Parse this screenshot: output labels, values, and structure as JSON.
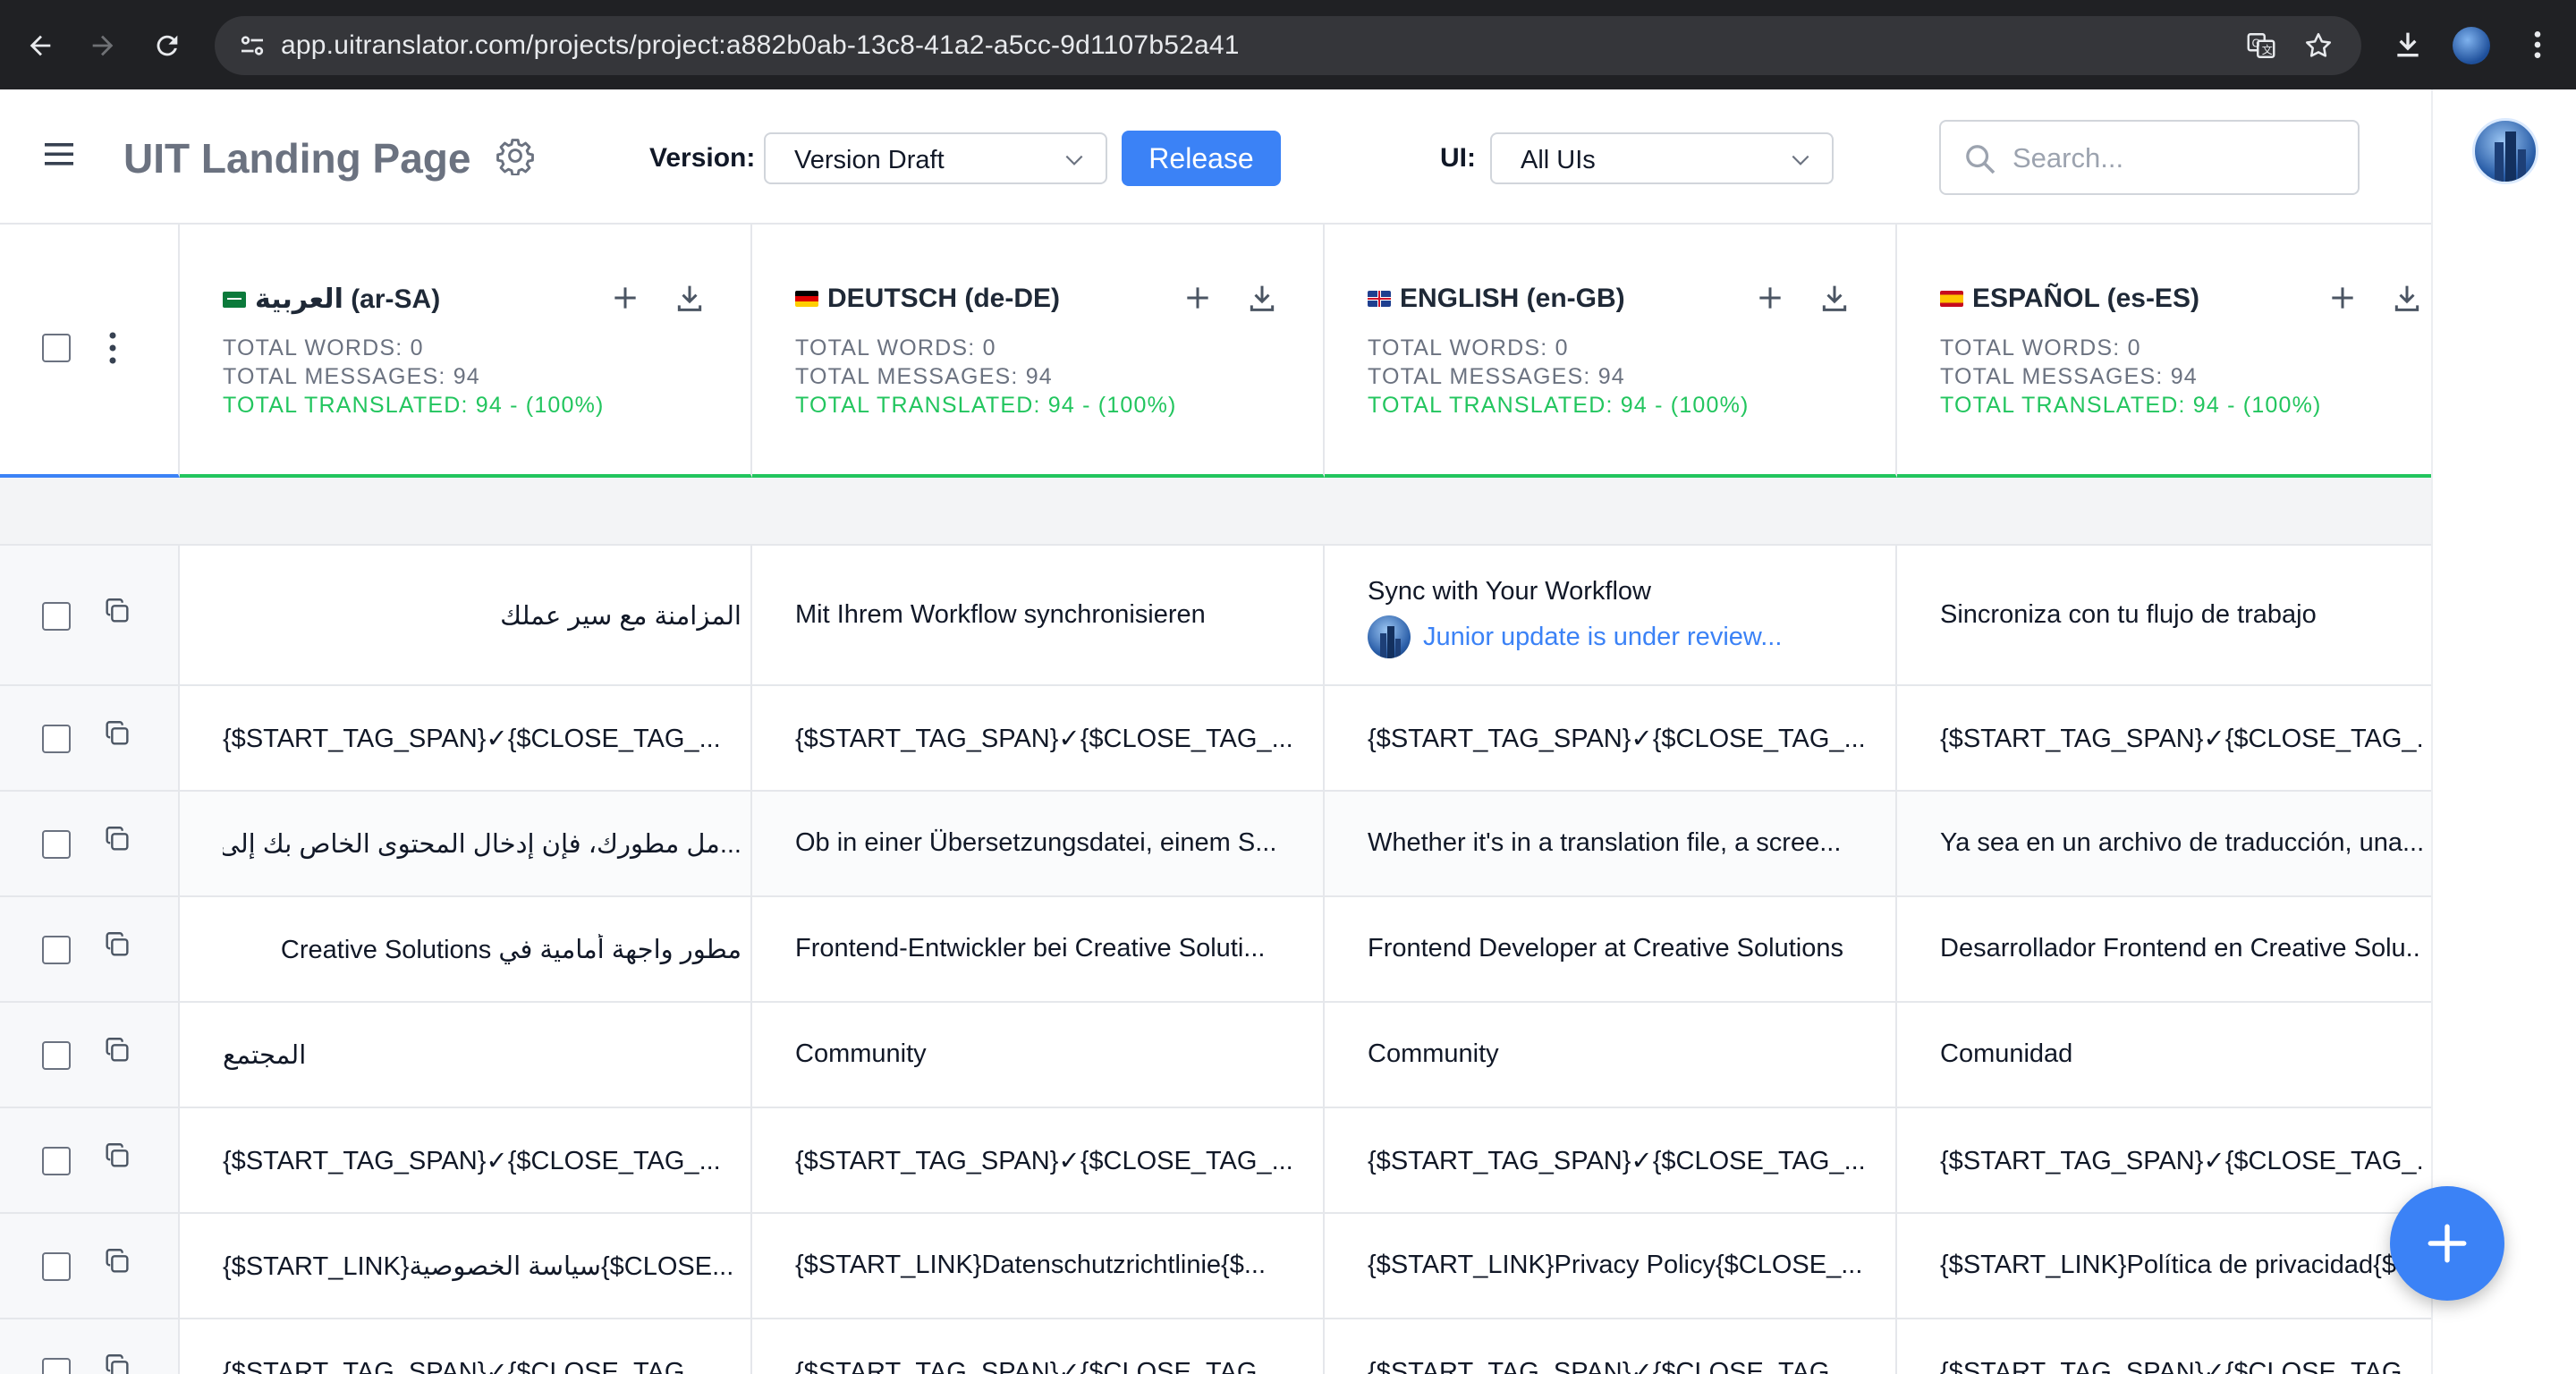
{
  "browser": {
    "url": "app.uitranslator.com/projects/project:a882b0ab-13c8-41a2-a5cc-9d1107b52a41"
  },
  "header": {
    "project_title": "UIT Landing Page",
    "version_label": "Version:",
    "version_value": "Version Draft",
    "release_label": "Release",
    "ui_label": "UI:",
    "ui_value": "All UIs",
    "search_placeholder": "Search..."
  },
  "languages": [
    {
      "name": "العربية (ar-SA)",
      "words": "TOTAL WORDS: 0",
      "messages": "TOTAL MESSAGES: 94",
      "translated": "TOTAL TRANSLATED: 94 - (100%)"
    },
    {
      "name": "DEUTSCH (de-DE)",
      "words": "TOTAL WORDS: 0",
      "messages": "TOTAL MESSAGES: 94",
      "translated": "TOTAL TRANSLATED: 94 - (100%)"
    },
    {
      "name": "ENGLISH (en-GB)",
      "words": "TOTAL WORDS: 0",
      "messages": "TOTAL MESSAGES: 94",
      "translated": "TOTAL TRANSLATED: 94 - (100%)"
    },
    {
      "name": "ESPAÑOL (es-ES)",
      "words": "TOTAL WORDS: 0",
      "messages": "TOTAL MESSAGES: 94",
      "translated": "TOTAL TRANSLATED: 94 - (100%)"
    }
  ],
  "rows": [
    [
      "المزامنة مع سير عملك",
      "Mit Ihrem Workflow synchronisieren",
      "Sync with Your Workflow",
      "Sincroniza con tu flujo de trabajo"
    ],
    [
      "{$START_TAG_SPAN}✓{$CLOSE_TAG_...",
      "{$START_TAG_SPAN}✓{$CLOSE_TAG_...",
      "{$START_TAG_SPAN}✓{$CLOSE_TAG_...",
      "{$START_TAG_SPAN}✓{$CLOSE_TAG_..."
    ],
    [
      "...مل مطورك، فإن إدخال المحتوى الخاص بك إلى",
      "Ob in einer Übersetzungsdatei, einem S...",
      "Whether it's in a translation file, a scree...",
      "Ya sea en un archivo de traducción, una..."
    ],
    [
      "مطور واجهة أمامية في Creative Solutions",
      "Frontend-Entwickler bei Creative Soluti...",
      "Frontend Developer at Creative Solutions",
      "Desarrollador Frontend en Creative Solu..."
    ],
    [
      "المجتمع",
      "Community",
      "Community",
      "Comunidad"
    ],
    [
      "{$START_TAG_SPAN}✓{$CLOSE_TAG_...",
      "{$START_TAG_SPAN}✓{$CLOSE_TAG_...",
      "{$START_TAG_SPAN}✓{$CLOSE_TAG_...",
      "{$START_TAG_SPAN}✓{$CLOSE_TAG_..."
    ],
    [
      "{$START_LINK}سياسة الخصوصية{$CLOSE...",
      "{$START_LINK}Datenschutzrichtlinie{$...",
      "{$START_LINK}Privacy Policy{$CLOSE_...",
      "{$START_LINK}Política de privacidad{$..."
    ],
    [
      "{$START_TAG_SPAN}✓{$CLOSE_TAG_...",
      "{$START_TAG_SPAN}✓{$CLOSE_TAG_...",
      "{$START_TAG_SPAN}✓{$CLOSE_TAG_...",
      "{$START_TAG_SPAN}✓{$CLOSE_TAG_..."
    ]
  ],
  "review_note": "Junior update is under review...",
  "colors": {
    "accent": "#3b82f6",
    "success": "#22c55e",
    "chrome_bg": "#202124"
  },
  "icons": [
    "back-icon",
    "forward-icon",
    "reload-icon",
    "site-info-icon",
    "translate-icon",
    "star-icon",
    "download-icon",
    "menu-icon",
    "gear-icon",
    "chevron-down-icon",
    "search-icon",
    "plus-icon",
    "copy-icon",
    "kebab-icon"
  ]
}
